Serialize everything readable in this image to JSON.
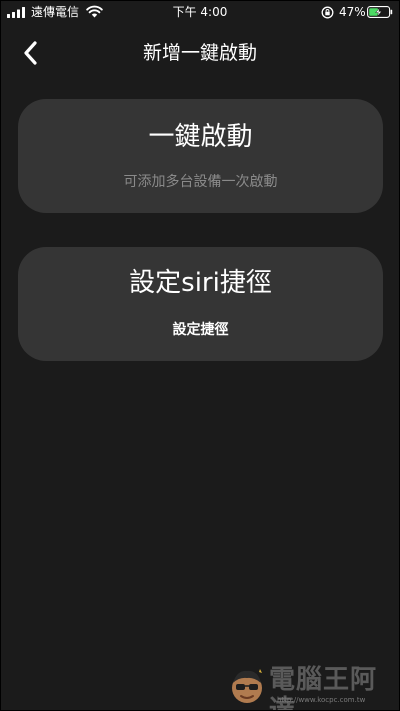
{
  "status_bar": {
    "carrier": "遠傳電信",
    "time": "下午 4:00",
    "battery_percent": "47%",
    "battery_level": 0.47
  },
  "nav": {
    "title": "新增一鍵啟動"
  },
  "cards": [
    {
      "title": "一鍵啟動",
      "subtitle": "可添加多台設備一次啟動"
    },
    {
      "title": "設定siri捷徑",
      "subtitle": "設定捷徑"
    }
  ],
  "watermark": {
    "text": "電腦王阿達",
    "url": "http://www.kocpc.com.tw"
  },
  "colors": {
    "background": "#1b1b1b",
    "card": "#353535",
    "subtitle_gray": "#8a8a8a",
    "battery_charging": "#4cd964"
  },
  "icons": {
    "signal": "cellular-signal-icon",
    "wifi": "wifi-icon",
    "orientation_lock": "orientation-lock-icon",
    "battery": "battery-charging-icon",
    "back": "chevron-left-icon"
  }
}
